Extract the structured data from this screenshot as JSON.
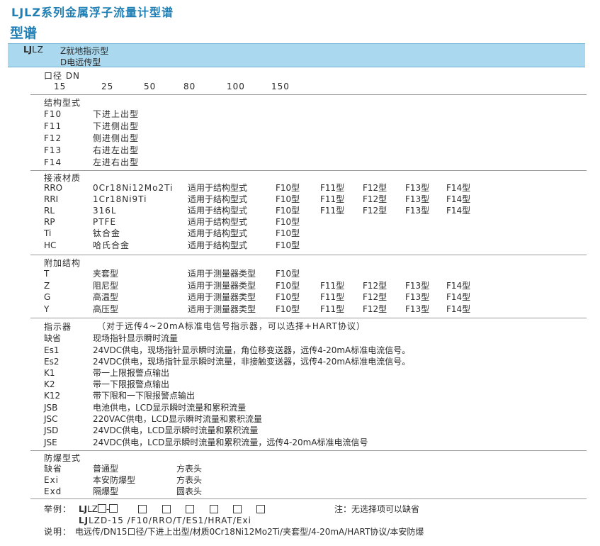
{
  "title": "LJLZ系列金属浮子流量计型谱",
  "subtitle": "型谱",
  "band": {
    "lj": "LJ",
    "lz": "LZ",
    "opt1": "Z就地指示型",
    "opt2": "D电远传型"
  },
  "dn": {
    "header": "口径 DN",
    "values": [
      "15",
      "25",
      "50",
      "80",
      "100",
      "150"
    ]
  },
  "structure": {
    "header": "结构型式",
    "rows": [
      [
        "F10",
        "下进上出型"
      ],
      [
        "F11",
        "下进侧出型"
      ],
      [
        "F12",
        "侧进侧出型"
      ],
      [
        "F13",
        "右进左出型"
      ],
      [
        "F14",
        "左进右出型"
      ]
    ]
  },
  "material": {
    "header": "接液材质",
    "rows": [
      [
        "RRO",
        "0Cr18Ni12Mo2Ti",
        "适用于结构型式",
        "F10型",
        "F11型",
        "F12型",
        "F13型",
        "F14型"
      ],
      [
        "RRI",
        "1Cr18Ni9Ti",
        "适用于结构型式",
        "F10型",
        "F11型",
        "F12型",
        "F13型",
        "F14型"
      ],
      [
        "RL",
        "316L",
        "适用于结构型式",
        "F10型",
        "F11型",
        "F12型",
        "F13型",
        "F14型"
      ],
      [
        "RP",
        "PTFE",
        "适用于结构型式",
        "F10型",
        "",
        "",
        "",
        ""
      ],
      [
        "Ti",
        "钛合金",
        "适用于结构型式",
        "F10型",
        "",
        "",
        "",
        ""
      ],
      [
        "HC",
        "哈氏合金",
        "适用于结构型式",
        "F10型",
        "",
        "",
        "",
        ""
      ]
    ]
  },
  "addon": {
    "header": "附加结构",
    "rows": [
      [
        "T",
        "夹套型",
        "适用于测量器类型",
        "F10型",
        "",
        "",
        "",
        ""
      ],
      [
        "Z",
        "阻尼型",
        "适用于测量器类型",
        "F10型",
        "F11型",
        "F12型",
        "F13型",
        "F14型"
      ],
      [
        "G",
        "高温型",
        "适用于测量器类型",
        "F10型",
        "F11型",
        "F12型",
        "F13型",
        "F14型"
      ],
      [
        "Y",
        "高压型",
        "适用于测量器类型",
        "F10型",
        "F11型",
        "F12型",
        "F13型",
        "F14型"
      ]
    ]
  },
  "indicator": {
    "header": "指示器",
    "note": "（对于远传4~20mA标准电信号指示器，可以选择+HART协议）",
    "rows": [
      [
        "缺省",
        "现场指针显示瞬时流量"
      ],
      [
        "Es1",
        "24VDC供电，现场指针显示瞬时流量，角位移变送器，远传4-20mA标准电流信号。"
      ],
      [
        "Es2",
        "24VDC供电，现场指针显示瞬时流量，非接触变送器，远传4-20mA标准电流信号。"
      ],
      [
        "K1",
        "带一上限报警点输出"
      ],
      [
        "K2",
        "带一下限报警点输出"
      ],
      [
        "K12",
        "带下限和一下限报警点输出"
      ],
      [
        "JSB",
        "电池供电，LCD显示瞬时流量和累积流量"
      ],
      [
        "JSC",
        "220VAC供电，LCD显示瞬时流量和累积流量"
      ],
      [
        "JSD",
        "24VDC供电，LCD显示瞬时流量和累积流量"
      ],
      [
        "JSE",
        "24VDC供电，LCD显示瞬时流量和累积流量，远传4-20mA标准电流信号"
      ]
    ]
  },
  "explosion": {
    "header": "防爆型式",
    "rows": [
      [
        "缺省",
        "普通型",
        "方表头"
      ],
      [
        "Exi",
        "本安防爆型",
        "方表头"
      ],
      [
        "Exd",
        "隔爆型",
        "圆表头"
      ]
    ]
  },
  "example": {
    "label": "举例：",
    "code_lj": "LJ",
    "code_lz": "LZ",
    "dash": "-",
    "note": "注：无选择项可以缺省",
    "line2_lj": "LJ",
    "line2_rest": "LZD-15 /F10/RRO/T/ES1/HRAT/Exi",
    "explain_label": "说明：",
    "explain": "电远传/DN15口径/下进上出型/材质0Cr18Ni12Mo2Ti/夹套型/4-20mA/HART协议/本安防爆"
  }
}
